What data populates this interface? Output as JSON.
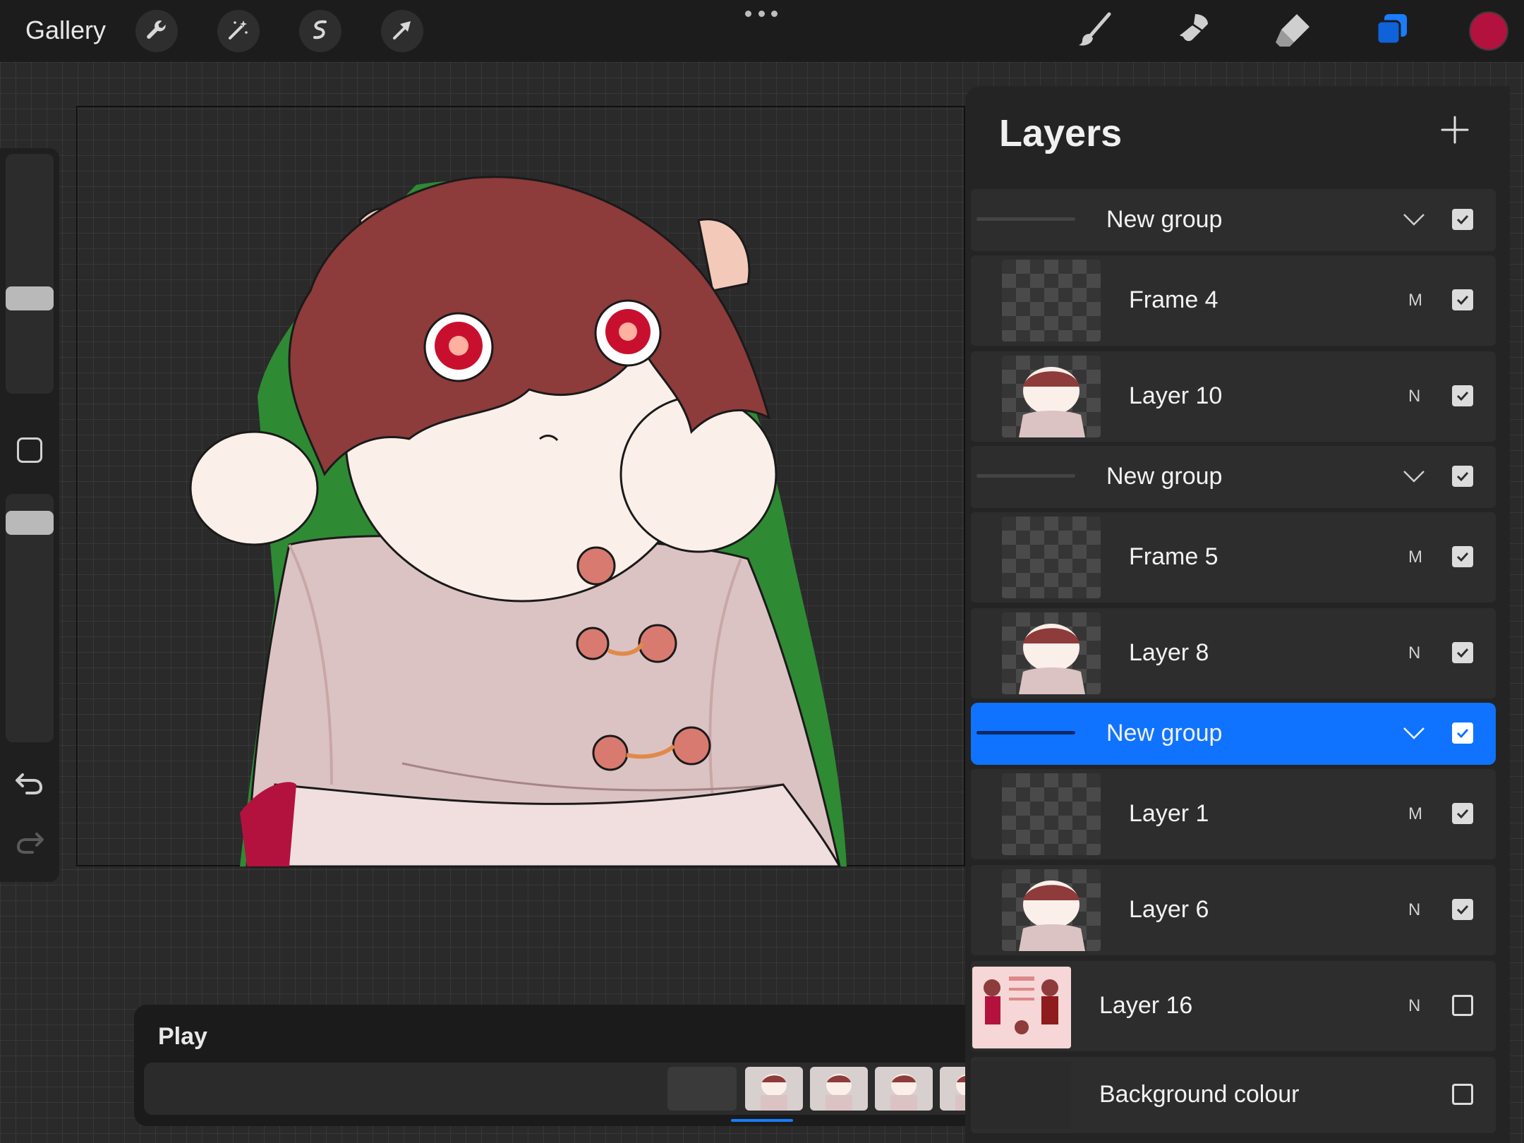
{
  "topbar": {
    "gallery_label": "Gallery",
    "left_tools": [
      "wrench-icon",
      "magic-wand-icon",
      "selection-s-icon",
      "transform-arrow-icon"
    ],
    "right_tools": [
      "brush-icon",
      "smudge-icon",
      "eraser-icon",
      "layers-icon"
    ],
    "active_tool": "layers-icon",
    "current_color": "#b3123f"
  },
  "timeline": {
    "play_label": "Play"
  },
  "layers": {
    "title": "Layers",
    "rows": [
      {
        "type": "group",
        "name": "New group",
        "visible": true,
        "selected": false
      },
      {
        "type": "layer",
        "name": "Frame 4",
        "mode": "M",
        "visible": true
      },
      {
        "type": "layer",
        "name": "Layer 10",
        "mode": "N",
        "visible": true
      },
      {
        "type": "group",
        "name": "New group",
        "visible": true,
        "selected": false
      },
      {
        "type": "layer",
        "name": "Frame 5",
        "mode": "M",
        "visible": true
      },
      {
        "type": "layer",
        "name": "Layer 8",
        "mode": "N",
        "visible": true
      },
      {
        "type": "group",
        "name": "New group",
        "visible": true,
        "selected": true
      },
      {
        "type": "layer",
        "name": "Layer 1",
        "mode": "M",
        "visible": true
      },
      {
        "type": "layer",
        "name": "Layer 6",
        "mode": "N",
        "visible": true
      },
      {
        "type": "layer",
        "name": "Layer 16",
        "mode": "N",
        "visible": false
      },
      {
        "type": "background",
        "name": "Background colour",
        "visible": false
      }
    ]
  },
  "colors": {
    "accent": "#0f73ff",
    "panel": "#242424",
    "row": "#2d2d2d"
  }
}
